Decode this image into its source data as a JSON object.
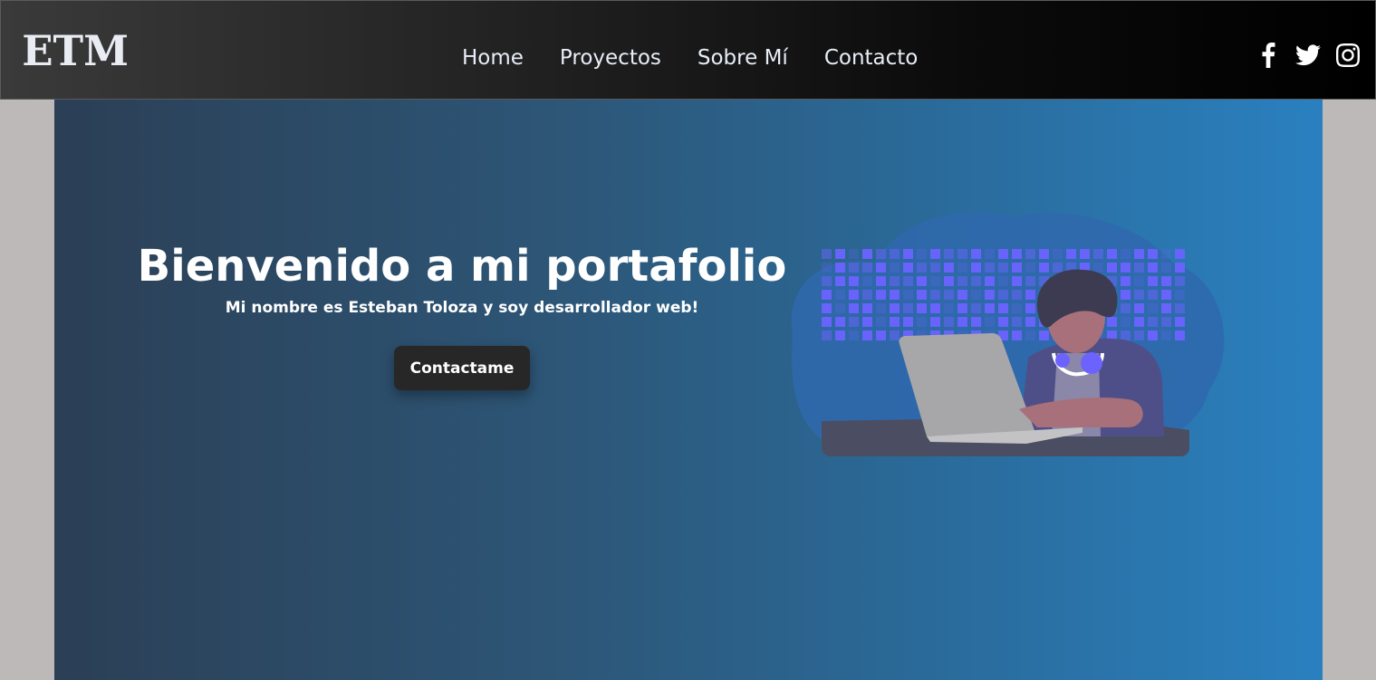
{
  "header": {
    "logo": "ETM",
    "nav": [
      {
        "label": "Home"
      },
      {
        "label": "Proyectos"
      },
      {
        "label": "Sobre Mí"
      },
      {
        "label": "Contacto"
      }
    ],
    "socials": [
      {
        "icon": "facebook-icon"
      },
      {
        "icon": "twitter-icon"
      },
      {
        "icon": "instagram-icon"
      }
    ]
  },
  "hero": {
    "title": "Bienvenido a mi portafolio",
    "subtitle": "Mi nombre es Esteban Toloza y soy desarrollador web!",
    "cta_label": "Contactame",
    "illustration": "developer-at-laptop-illustration"
  },
  "colors": {
    "navbar_dark": "#000000",
    "hero_left": "#2b3f55",
    "hero_right": "#2a80bf",
    "accent_purple": "#6c63ff",
    "button_bg": "#272727",
    "page_bg": "#bdb9b8"
  }
}
